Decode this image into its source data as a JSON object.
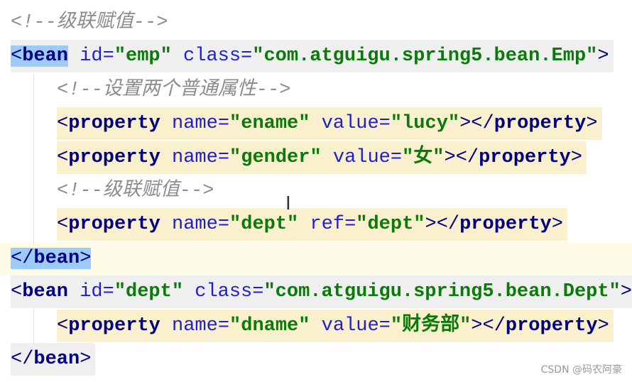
{
  "editor": {
    "lines": [
      {
        "indent": 0,
        "bg": "none",
        "tokens": [
          [
            "comment",
            "<!--级联赋值-->"
          ]
        ]
      },
      {
        "indent": 0,
        "bg": "gray",
        "tokens": [
          [
            "matchp",
            "<"
          ],
          [
            "match",
            "bean"
          ],
          [
            "attr",
            " id="
          ],
          [
            "val",
            "\"emp\""
          ],
          [
            "attr",
            " class="
          ],
          [
            "val",
            "\"com.atguigu.spring5.bean.Emp\""
          ],
          [
            "punct",
            ">"
          ]
        ]
      },
      {
        "indent": 1,
        "bg": "none",
        "tokens": [
          [
            "comment",
            "<!--设置两个普通属性-->"
          ]
        ]
      },
      {
        "indent": 1,
        "bg": "yellow",
        "tokens": [
          [
            "punct",
            "<"
          ],
          [
            "tag",
            "property"
          ],
          [
            "attr",
            " name="
          ],
          [
            "val",
            "\"ename\""
          ],
          [
            "attr",
            " value="
          ],
          [
            "val",
            "\"lucy\""
          ],
          [
            "punct",
            "></"
          ],
          [
            "tag",
            "property"
          ],
          [
            "punct",
            ">"
          ]
        ]
      },
      {
        "indent": 1,
        "bg": "yellow",
        "tokens": [
          [
            "punct",
            "<"
          ],
          [
            "tag",
            "property"
          ],
          [
            "attr",
            " name="
          ],
          [
            "val",
            "\"gender\""
          ],
          [
            "attr",
            " value="
          ],
          [
            "val",
            "\"女\""
          ],
          [
            "punct",
            "></"
          ],
          [
            "tag",
            "property"
          ],
          [
            "punct",
            ">"
          ]
        ]
      },
      {
        "indent": 1,
        "bg": "none",
        "tokens": [
          [
            "comment",
            "<!--级联赋值-->"
          ]
        ]
      },
      {
        "indent": 1,
        "bg": "yellow",
        "tokens": [
          [
            "punct",
            "<"
          ],
          [
            "tag",
            "property"
          ],
          [
            "attr",
            " name="
          ],
          [
            "val",
            "\"dept\""
          ],
          [
            "attr",
            " ref="
          ],
          [
            "val",
            "\"dept\""
          ],
          [
            "punct",
            "></"
          ],
          [
            "tag",
            "property"
          ],
          [
            "punct",
            ">"
          ]
        ]
      },
      {
        "indent": 0,
        "bg": "caret",
        "tokens": [
          [
            "matchp",
            "</"
          ],
          [
            "match",
            "bean"
          ],
          [
            "matchp",
            ">"
          ]
        ]
      },
      {
        "indent": 0,
        "bg": "gray",
        "tokens": [
          [
            "punct",
            "<"
          ],
          [
            "tag",
            "bean"
          ],
          [
            "attr",
            " id="
          ],
          [
            "val",
            "\"dept\""
          ],
          [
            "attr",
            " class="
          ],
          [
            "val",
            "\"com.atguigu.spring5.bean.Dept\""
          ],
          [
            "punct",
            ">"
          ]
        ]
      },
      {
        "indent": 1,
        "bg": "yellow",
        "tokens": [
          [
            "punct",
            "<"
          ],
          [
            "tag",
            "property"
          ],
          [
            "attr",
            " name="
          ],
          [
            "val",
            "\"dname\""
          ],
          [
            "attr",
            " value="
          ],
          [
            "val",
            "\"财务部\""
          ],
          [
            "punct",
            "></"
          ],
          [
            "tag",
            "property"
          ],
          [
            "punct",
            ">"
          ]
        ]
      },
      {
        "indent": 0,
        "bg": "gray",
        "tokens": [
          [
            "punct",
            "</"
          ],
          [
            "tag",
            "bean"
          ],
          [
            "punct",
            ">"
          ]
        ]
      }
    ]
  },
  "cursor_glyph": "I",
  "watermark": "CSDN @码农阿豪"
}
